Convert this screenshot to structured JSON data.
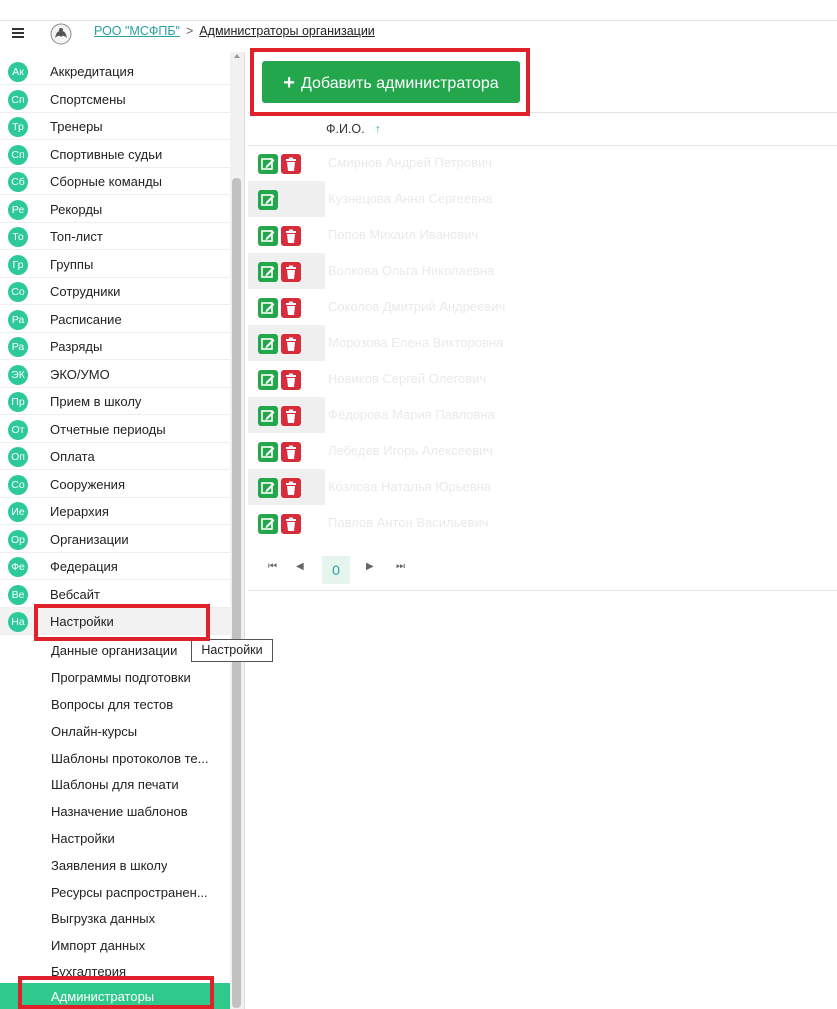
{
  "breadcrumb": {
    "org": "РОО \"МСФПБ\"",
    "separator": ">",
    "current": "Администраторы организации"
  },
  "sidebar": {
    "items": [
      {
        "badge": "Ак",
        "label": "Аккредитация"
      },
      {
        "badge": "Сп",
        "label": "Спортсмены"
      },
      {
        "badge": "Тр",
        "label": "Тренеры"
      },
      {
        "badge": "Сп",
        "label": "Спортивные судьи"
      },
      {
        "badge": "Сб",
        "label": "Сборные команды"
      },
      {
        "badge": "Ре",
        "label": "Рекорды"
      },
      {
        "badge": "То",
        "label": "Топ-лист"
      },
      {
        "badge": "Гр",
        "label": "Группы"
      },
      {
        "badge": "Со",
        "label": "Сотрудники"
      },
      {
        "badge": "Ра",
        "label": "Расписание"
      },
      {
        "badge": "Ра",
        "label": "Разряды"
      },
      {
        "badge": "ЭК",
        "label": "ЭКО/УМО"
      },
      {
        "badge": "Пр",
        "label": "Прием в школу"
      },
      {
        "badge": "От",
        "label": "Отчетные периоды"
      },
      {
        "badge": "Оп",
        "label": "Оплата"
      },
      {
        "badge": "Со",
        "label": "Сооружения"
      },
      {
        "badge": "Ие",
        "label": "Иерархия"
      },
      {
        "badge": "Ор",
        "label": "Организации"
      },
      {
        "badge": "Фе",
        "label": "Федерация"
      },
      {
        "badge": "Ве",
        "label": "Вебсайт"
      },
      {
        "badge": "На",
        "label": "Настройки"
      }
    ],
    "subitems": [
      "Данные организации",
      "Программы подготовки",
      "Вопросы для тестов",
      "Онлайн-курсы",
      "Шаблоны протоколов те...",
      "Шаблоны для печати",
      "Назначение шаблонов",
      "Настройки",
      "Заявления в школу",
      "Ресурсы распространен...",
      "Выгрузка данных",
      "Импорт данных",
      "Бухгалтерия",
      "Администраторы"
    ],
    "tooltip": "Настройки"
  },
  "main": {
    "add_button": "Добавить администратора",
    "column_header": "Ф.И.О.",
    "sort_arrow": "↑",
    "rows": [
      {
        "name": "Смирнов Андрей Петрович",
        "deletable": true
      },
      {
        "name": "Кузнецова Анна Сергеевна",
        "deletable": false
      },
      {
        "name": "Попов Михаил Иванович",
        "deletable": true
      },
      {
        "name": "Волкова Ольга Николаевна",
        "deletable": true
      },
      {
        "name": "Соколов Дмитрий Андреевич",
        "deletable": true
      },
      {
        "name": "Морозова Елена Викторовна",
        "deletable": true
      },
      {
        "name": "Новиков Сергей Олегович",
        "deletable": true
      },
      {
        "name": "Фёдорова Мария Павловна",
        "deletable": true
      },
      {
        "name": "Лебедев Игорь Алексеевич",
        "deletable": true
      },
      {
        "name": "Козлова Наталья Юрьевна",
        "deletable": true
      },
      {
        "name": "Павлов Антон Васильевич",
        "deletable": true
      }
    ],
    "pager": {
      "first": "⏮",
      "prev": "◀",
      "current": "0",
      "next": "▶",
      "last": "⏭"
    }
  },
  "colors": {
    "accent": "#2ec99b",
    "add_button": "#24a64d",
    "delete": "#d72d3b",
    "annotation": "#e0202a"
  }
}
